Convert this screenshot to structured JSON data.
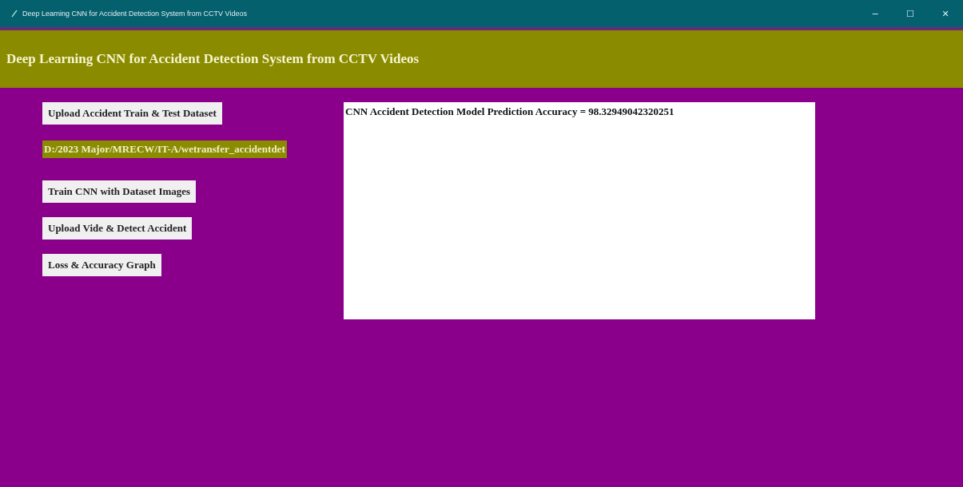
{
  "window": {
    "title": "Deep Learning CNN for Accident Detection System from CCTV Videos",
    "controls": [
      "−",
      "☐",
      "✕"
    ]
  },
  "header": {
    "title": "Deep Learning CNN for Accident Detection System from CCTV Videos"
  },
  "controls": [
    {
      "kind": "button",
      "label": "Upload Accident Train & Test Dataset"
    },
    {
      "kind": "path",
      "label": "D:/2023 Major/MRECW/IT-A/wetransfer_accidentdet"
    },
    {
      "kind": "button",
      "label": "Train CNN with Dataset Images"
    },
    {
      "kind": "button",
      "label": "Upload Vide & Detect Accident"
    },
    {
      "kind": "button",
      "label": "Loss & Accuracy Graph"
    }
  ],
  "output": {
    "lines": [
      "CNN Accident Detection Model Prediction Accuracy = 98.32949042320251"
    ]
  }
}
